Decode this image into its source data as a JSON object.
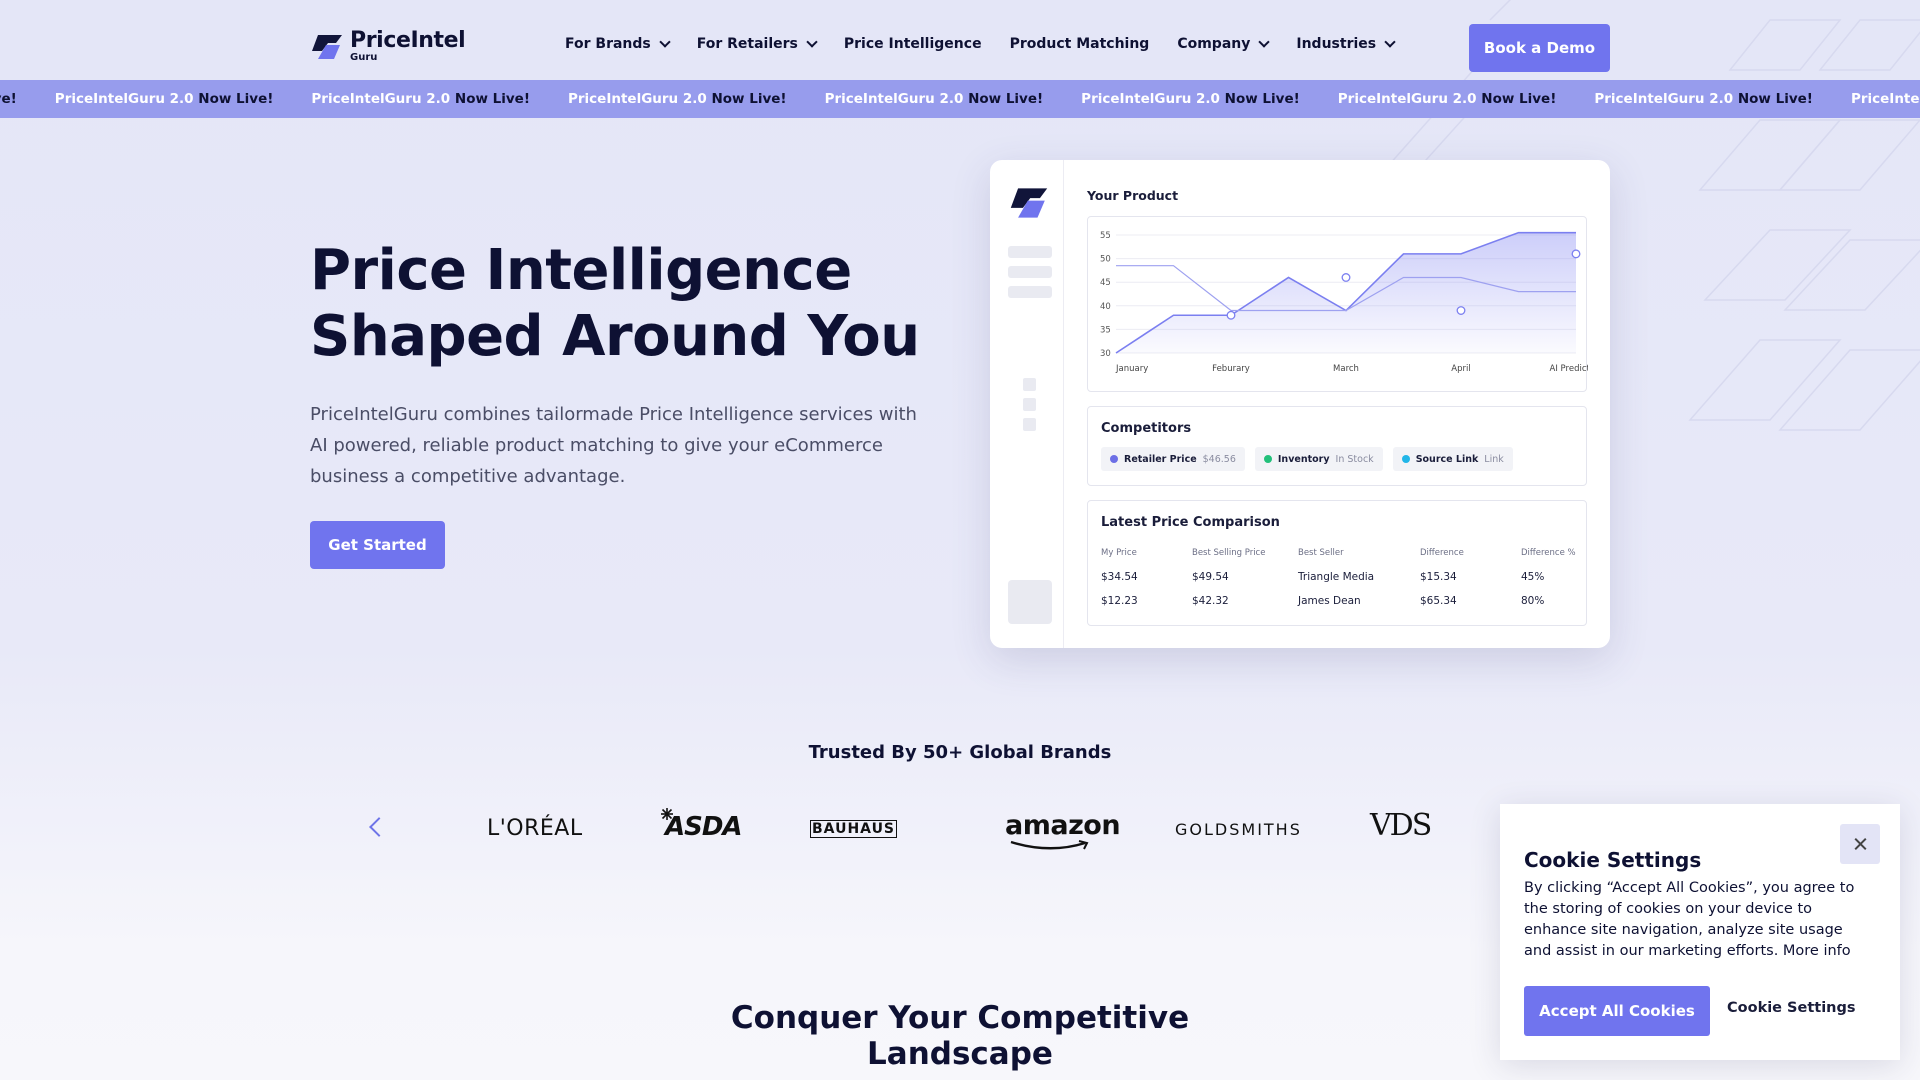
{
  "header": {
    "logo_main": "PriceIntel",
    "logo_sub": "Guru",
    "nav": [
      {
        "label": "For Brands",
        "dropdown": true
      },
      {
        "label": "For Retailers",
        "dropdown": true
      },
      {
        "label": "Price Intelligence",
        "dropdown": false
      },
      {
        "label": "Product Matching",
        "dropdown": false
      },
      {
        "label": "Company",
        "dropdown": true
      },
      {
        "label": "Industries",
        "dropdown": true
      }
    ],
    "cta": "Book a Demo"
  },
  "ticker": {
    "first_tail": "ow Live!",
    "brand": "PriceIntelGuru 2.0",
    "status": "Now Live!"
  },
  "hero": {
    "title_line1": "Price Intelligence",
    "title_line2": "Shaped Around You",
    "description": "PriceIntelGuru combines tailormade Price Intelligence services with AI powered, reliable product matching to give your eCommerce business a competitive advantage.",
    "cta": "Get Started"
  },
  "dashboard": {
    "title": "Your Product",
    "competitors_title": "Competitors",
    "chips": [
      {
        "label": "Retailer Price",
        "value": "$46.56",
        "color": "#6c6fe6"
      },
      {
        "label": "Inventory",
        "value": "In Stock",
        "color": "#22c07a"
      },
      {
        "label": "Source Link",
        "value": "Link",
        "color": "#22b6e8"
      }
    ],
    "comparison_title": "Latest Price Comparison",
    "table": {
      "headers": [
        "My Price",
        "Best Selling Price",
        "Best Seller",
        "Difference",
        "Difference %"
      ],
      "rows": [
        [
          "$34.54",
          "$49.54",
          "Triangle Media",
          "$15.34",
          "45%"
        ],
        [
          "$12.23",
          "$42.32",
          "James Dean",
          "$65.34",
          "80%"
        ]
      ]
    }
  },
  "chart_data": {
    "type": "line",
    "title": "Your Product",
    "categories": [
      "January",
      "Feburary",
      "March",
      "April",
      "AI Predictive"
    ],
    "yticks": [
      55,
      50,
      45,
      40,
      35,
      30
    ],
    "ylim": [
      30,
      55
    ],
    "x": [
      0,
      0.5,
      1,
      1.5,
      2,
      2.5,
      3,
      3.5,
      4
    ],
    "series": [
      {
        "color": "#7b7ff0",
        "fill": true,
        "values": [
          30,
          38,
          38,
          46,
          39,
          51,
          51,
          55.5,
          55.5
        ]
      },
      {
        "color": "#9ea1f0",
        "fill": false,
        "values": [
          48.5,
          48.5,
          39,
          39,
          39,
          46,
          46,
          43,
          43
        ]
      }
    ],
    "markers": [
      [
        1,
        38
      ],
      [
        2,
        46
      ],
      [
        3,
        39
      ],
      [
        4,
        51
      ]
    ]
  },
  "trusted": {
    "heading": "Trusted By 50+ Global Brands",
    "brands": [
      "L'ORÉAL",
      "ASDA",
      "BAUHAUS",
      "amazon",
      "GOLDSMITHS",
      "VDS"
    ]
  },
  "section": {
    "heading_line1": "Conquer Your Competitive",
    "heading_line2": "Landscape"
  },
  "cookie": {
    "title": "Cookie Settings",
    "text": "By clicking “Accept All Cookies”, you agree to the storing of cookies on your device to enhance site navigation, analyze site usage and assist in our marketing efforts. More info",
    "accept": "Accept All Cookies",
    "settings": "Cookie Settings"
  },
  "colors": {
    "accent": "#7074ee",
    "ticker_bg": "#979ced",
    "text": "#0e1133"
  }
}
